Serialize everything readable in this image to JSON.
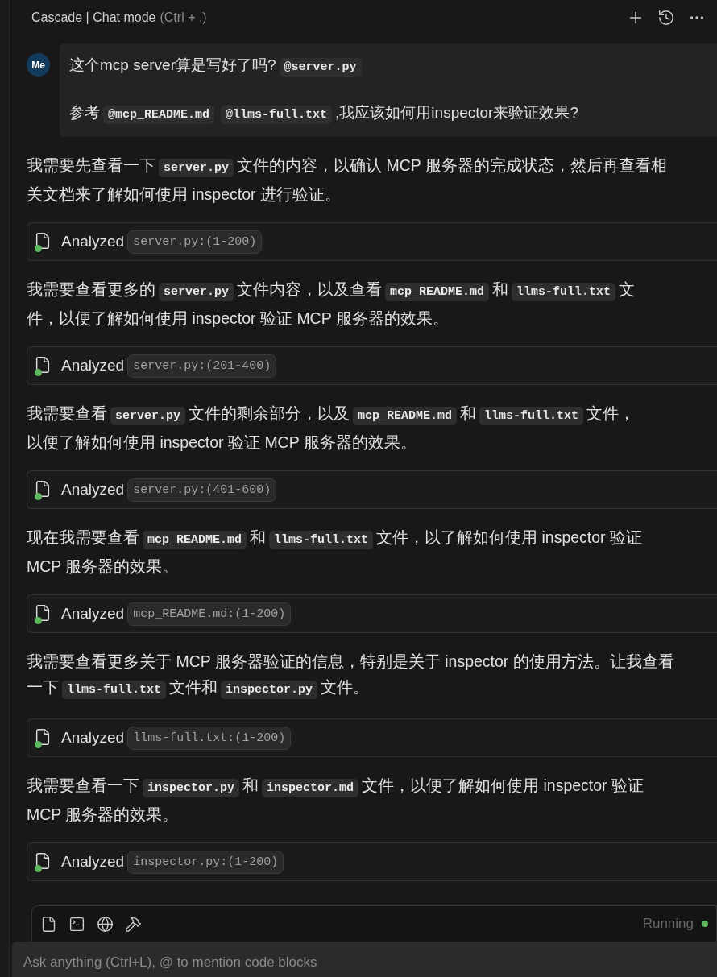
{
  "header": {
    "title": "Cascade | Chat mode",
    "shortcut": "(Ctrl + .)"
  },
  "user_message": {
    "avatar": "Me",
    "lines": [
      [
        {
          "kind": "text",
          "text": "这个mcp server算是写好了吗?"
        },
        {
          "kind": "mention",
          "text": "@server.py"
        }
      ],
      [
        {
          "kind": "text",
          "text": "参考"
        },
        {
          "kind": "mention",
          "text": "@mcp_README.md"
        },
        {
          "kind": "mention",
          "text": "@llms-full.txt"
        },
        {
          "kind": "text",
          "text": ",我应该如何用inspector来验证效果?"
        }
      ]
    ]
  },
  "steps": [
    {
      "paragraph": [
        {
          "kind": "text",
          "text": "我需要先查看一下"
        },
        {
          "kind": "code",
          "text": "server.py"
        },
        {
          "kind": "text",
          "text": "文件的内容，以确认 MCP 服务器的完成状态，然后再查看相"
        },
        {
          "kind": "break"
        },
        {
          "kind": "text",
          "text": "关文档来了解如何使用 inspector 进行验证。"
        }
      ],
      "action": {
        "label": "Analyzed",
        "file": "server.py:(1-200)"
      }
    },
    {
      "paragraph": [
        {
          "kind": "text",
          "text": "我需要查看更多的"
        },
        {
          "kind": "link",
          "text": "server.py"
        },
        {
          "kind": "text",
          "text": "文件内容，以及查看"
        },
        {
          "kind": "code",
          "text": "mcp_README.md"
        },
        {
          "kind": "text",
          "text": "和"
        },
        {
          "kind": "code",
          "text": "llms-full.txt"
        },
        {
          "kind": "text",
          "text": "文"
        },
        {
          "kind": "break"
        },
        {
          "kind": "text",
          "text": "件，以便了解如何使用 inspector 验证 MCP 服务器的效果。"
        }
      ],
      "action": {
        "label": "Analyzed",
        "file": "server.py:(201-400)"
      }
    },
    {
      "paragraph": [
        {
          "kind": "text",
          "text": "我需要查看"
        },
        {
          "kind": "code",
          "text": "server.py"
        },
        {
          "kind": "text",
          "text": "文件的剩余部分，以及"
        },
        {
          "kind": "code",
          "text": "mcp_README.md"
        },
        {
          "kind": "text",
          "text": "和"
        },
        {
          "kind": "code",
          "text": "llms-full.txt"
        },
        {
          "kind": "text",
          "text": "文件，"
        },
        {
          "kind": "break"
        },
        {
          "kind": "text",
          "text": "以便了解如何使用 inspector 验证 MCP 服务器的效果。"
        }
      ],
      "action": {
        "label": "Analyzed",
        "file": "server.py:(401-600)"
      }
    },
    {
      "paragraph": [
        {
          "kind": "text",
          "text": "现在我需要查看"
        },
        {
          "kind": "code",
          "text": "mcp_README.md"
        },
        {
          "kind": "text",
          "text": "和"
        },
        {
          "kind": "code",
          "text": "llms-full.txt"
        },
        {
          "kind": "text",
          "text": "文件，以了解如何使用 inspector 验证"
        },
        {
          "kind": "break"
        },
        {
          "kind": "text",
          "text": "MCP 服务器的效果。"
        }
      ],
      "action": {
        "label": "Analyzed",
        "file": "mcp_README.md:(1-200)"
      }
    },
    {
      "paragraph": [
        {
          "kind": "text",
          "text": "我需要查看更多关于 MCP 服务器验证的信息，特别是关于 inspector 的使用方法。让我查看"
        },
        {
          "kind": "break"
        },
        {
          "kind": "text",
          "text": "一下"
        },
        {
          "kind": "code",
          "text": "llms-full.txt"
        },
        {
          "kind": "text",
          "text": "文件和"
        },
        {
          "kind": "code",
          "text": "inspector.py"
        },
        {
          "kind": "text",
          "text": "文件。"
        }
      ],
      "action": {
        "label": "Analyzed",
        "file": "llms-full.txt:(1-200)"
      }
    },
    {
      "paragraph": [
        {
          "kind": "text",
          "text": "我需要查看一下"
        },
        {
          "kind": "code",
          "text": "inspector.py"
        },
        {
          "kind": "text",
          "text": "和"
        },
        {
          "kind": "code",
          "text": "inspector.md"
        },
        {
          "kind": "text",
          "text": "文件，以便了解如何使用 inspector 验证"
        },
        {
          "kind": "break"
        },
        {
          "kind": "text",
          "text": "MCP 服务器的效果。"
        }
      ],
      "action": {
        "label": "Analyzed",
        "file": "inspector.py:(1-200)"
      }
    }
  ],
  "status": {
    "text": "Running",
    "running": true
  },
  "input": {
    "placeholder": "Ask anything (Ctrl+L), @ to mention code blocks"
  }
}
